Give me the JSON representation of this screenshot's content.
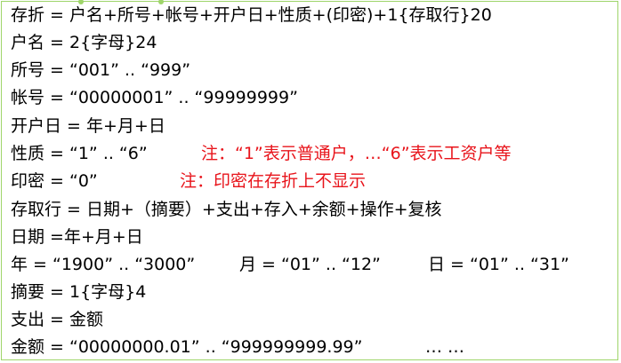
{
  "lines": [
    {
      "main": "存折 = 户名+所号+帐号+开户日+性质+(印密)+1{存取行}20"
    },
    {
      "main": "户名 = 2{字母}24"
    },
    {
      "main": "所号 = “001” .. “999”"
    },
    {
      "main": "帐号 = “00000001” .. “99999999”"
    },
    {
      "main": "开户日 = 年+月+日"
    },
    {
      "main": "性质 = “1” .. “6”",
      "note": "注：“1”表示普通户，…“6”表示工资户等"
    },
    {
      "main": "印密 = “0”",
      "note": "注：印密在存折上不显示"
    },
    {
      "main": "存取行 = 日期+（摘要）+支出+存入+余额+操作+复核"
    },
    {
      "main": "日期 =年+月+日"
    },
    {
      "main": "年 = “1900” .. “3000”",
      "part2": "月 = “01” .. “12”",
      "part3": "日 = “01” .. “31”"
    },
    {
      "main": "摘要 = 1{字母}4"
    },
    {
      "main": "支出 = 金额"
    },
    {
      "main": "金额 = “00000000.01” .. “999999999.99”",
      "tail": "… …"
    }
  ]
}
